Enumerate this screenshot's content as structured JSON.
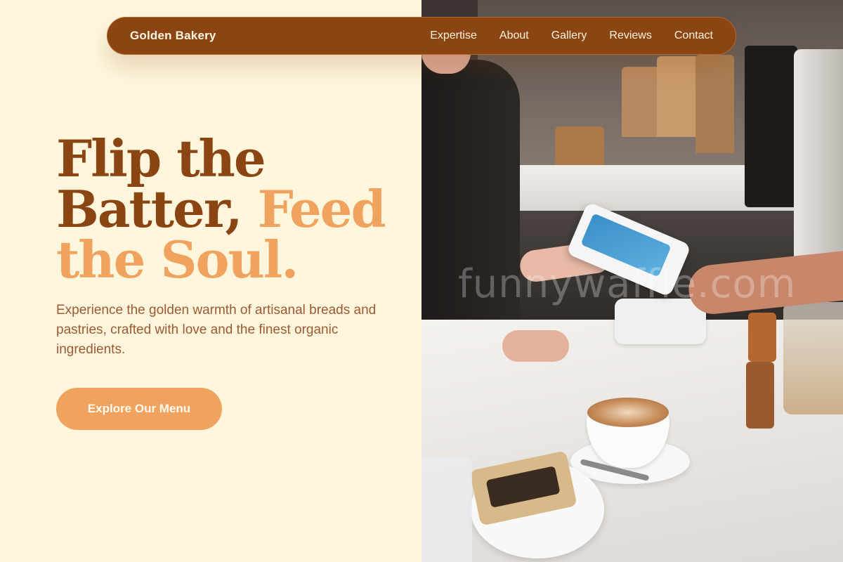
{
  "nav": {
    "brand": "Golden Bakery",
    "links": [
      "Expertise",
      "About",
      "Gallery",
      "Reviews",
      "Contact"
    ]
  },
  "hero": {
    "title_part1": "Flip the Batter,",
    "title_part2": "Feed the Soul.",
    "subtitle": "Experience the golden warmth of artisanal breads and pastries, crafted with love and the finest organic ingredients.",
    "cta_label": "Explore Our Menu"
  },
  "watermark": "funnywaffle.com",
  "colors": {
    "background": "#fef6dc",
    "brand_brown": "#8b4513",
    "accent_orange": "#f0a35e",
    "nav_text": "#fff3dc"
  },
  "images": {
    "hero_photo": "cafe-counter-card-payment-with-latte-photo"
  }
}
